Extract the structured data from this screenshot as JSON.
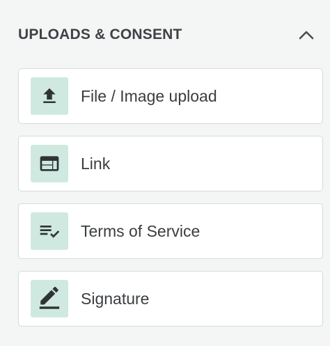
{
  "section": {
    "title": "UPLOADS & CONSENT",
    "toggle_icon": "chevron-up-icon"
  },
  "colors": {
    "icon_bg": "#cfe9e0",
    "icon_fg": "#2f3336",
    "card_border": "#d6d9dc",
    "title_text": "#3f4246"
  },
  "fields": [
    {
      "label": "File / Image upload",
      "icon": "upload-icon"
    },
    {
      "label": "Link",
      "icon": "browser-window-icon"
    },
    {
      "label": "Terms of Service",
      "icon": "checklist-icon"
    },
    {
      "label": "Signature",
      "icon": "pen-signature-icon"
    }
  ]
}
